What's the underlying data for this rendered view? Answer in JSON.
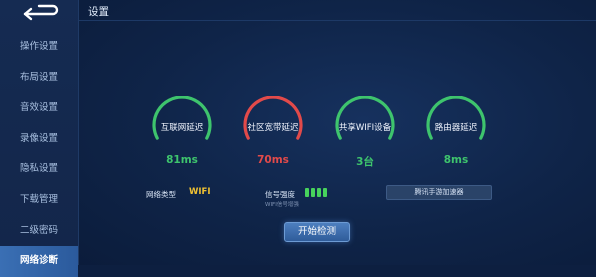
{
  "colors": {
    "accent": "#3a6fb4",
    "good": "#3ec46d",
    "bad": "#e24a4a",
    "wifi": "#f1c232"
  },
  "sidebar": {
    "back_icon": "back-arrow-icon",
    "items": [
      {
        "label": "操作设置"
      },
      {
        "label": "布局设置"
      },
      {
        "label": "音效设置"
      },
      {
        "label": "录像设置"
      },
      {
        "label": "隐私设置"
      },
      {
        "label": "下载管理"
      },
      {
        "label": "二级密码"
      },
      {
        "label": "网络诊断",
        "active": true
      }
    ]
  },
  "header": {
    "title": "设置"
  },
  "gauges": [
    {
      "label": "互联网延迟",
      "value": "81ms",
      "status": "good"
    },
    {
      "label": "社区宽带延迟",
      "value": "70ms",
      "status": "bad"
    },
    {
      "label": "共享WIFI设备",
      "value": "3台",
      "status": "good"
    },
    {
      "label": "路由器延迟",
      "value": "8ms",
      "status": "good"
    }
  ],
  "network": {
    "type_label": "网络类型",
    "type_value": "WIFI",
    "signal_label": "信号强度",
    "signal_level": 1.0,
    "signal_sublabel": "WIFI信号增强"
  },
  "boost_button": "腾讯手游加速器",
  "start_button": "开始检测"
}
